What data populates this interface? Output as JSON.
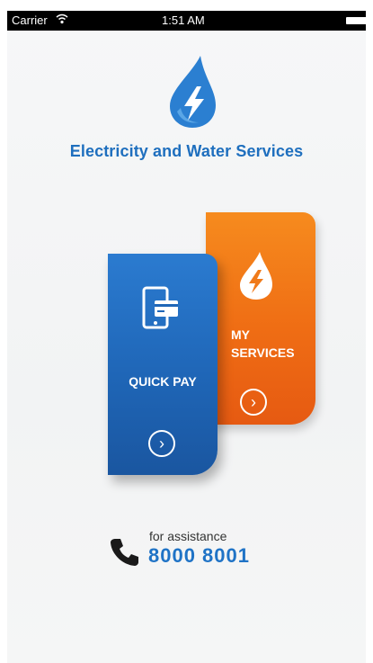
{
  "status_bar": {
    "carrier": "Carrier",
    "time": "1:51 AM"
  },
  "brand": {
    "title": "Electricity and Water Services",
    "logo_icon": "flame-lightning-icon"
  },
  "cards": {
    "my_services": {
      "label_line1": "MY",
      "label_line2": "SERVICES",
      "icon": "water-drop-lightning-icon",
      "color": "#f07a1a"
    },
    "quick_pay": {
      "label": "QUICK PAY",
      "icon": "tablet-card-icon",
      "color": "#2370c4"
    }
  },
  "assistance": {
    "caption": "for assistance",
    "number": "8000 8001"
  },
  "colors": {
    "brand_blue": "#1e6fbe",
    "accent_orange": "#f07a1a"
  }
}
